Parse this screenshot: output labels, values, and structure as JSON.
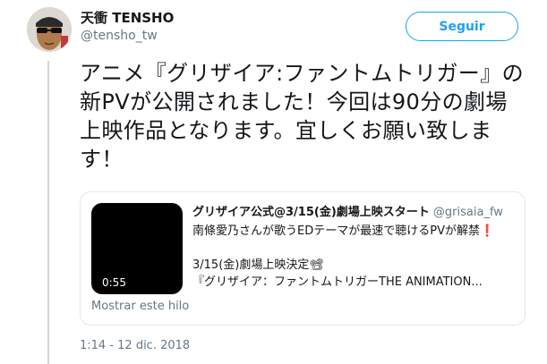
{
  "header": {
    "display_name": "天衝 TENSHO",
    "handle": "@tensho_tw",
    "follow_label": "Seguir"
  },
  "tweet": {
    "text": "アニメ『グリザイア:ファントムトリガー』の新PVが公開されました！今回は90分の劇場上映作品となります。宜しくお願い致します！"
  },
  "quoted_card": {
    "author_name": "グリザイア公式@3/15(金)劇場上映スタート",
    "author_handle": "@grisaia_fw",
    "line1": "南條愛乃さんが歌うEDテーマが最速で聴けるPVが解禁❗",
    "line3": "3/15(金)劇場上映決定📽",
    "line4": "『グリザイア：ファントムトリガーTHE ANIMATION...",
    "video_duration": "0:55",
    "show_thread": "Mostrar este hilo"
  },
  "footer": {
    "timestamp": "1:14 - 12 dic. 2018"
  },
  "colors": {
    "accent": "#1da1f2",
    "secondary_text": "#657786",
    "border": "#e1e8ed",
    "thread_line": "#ccd6dd"
  }
}
